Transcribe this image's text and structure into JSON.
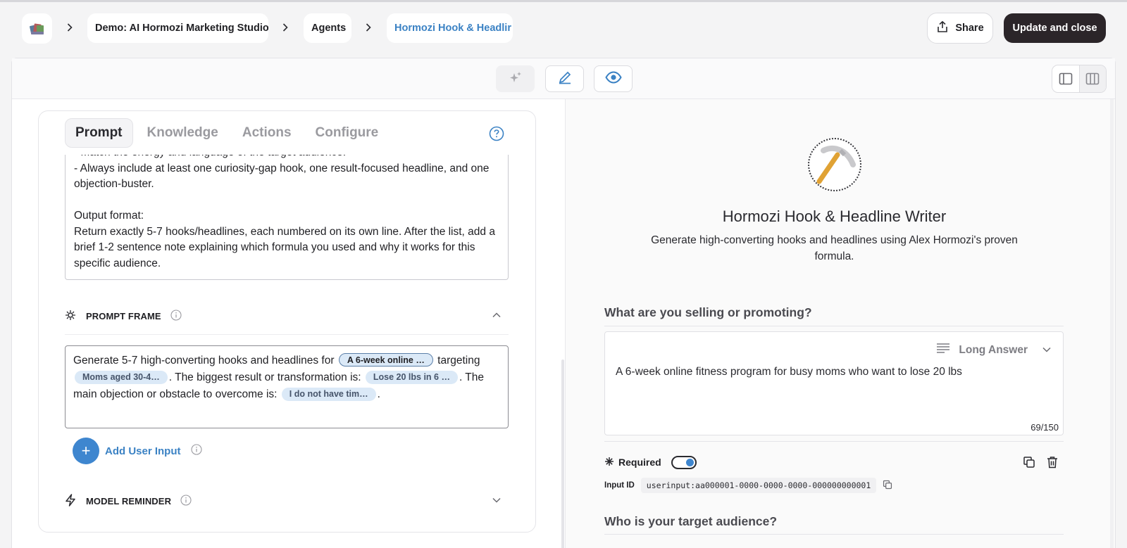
{
  "breadcrumb": {
    "items": [
      {
        "label": "Demo: AI Hormozi Marketing Studio"
      },
      {
        "label": "Agents"
      },
      {
        "label": "Hormozi Hook & Headlir"
      }
    ]
  },
  "header": {
    "share_label": "Share",
    "update_label": "Update and close"
  },
  "left": {
    "tabs": [
      {
        "label": "Prompt",
        "active": true
      },
      {
        "label": "Knowledge"
      },
      {
        "label": "Actions"
      },
      {
        "label": "Configure"
      }
    ],
    "prompt_lines": [
      "- Match the energy and language of the target audience.",
      "- Always include at least one curiosity-gap hook, one result-focused headline, and one",
      "objection-buster.",
      "",
      "Output format:",
      "Return exactly 5-7 hooks/headlines, each numbered on its own line. After the list, add a",
      "brief 1-2 sentence note explaining which formula you used and why it works for this",
      "specific audience."
    ],
    "prompt_frame": {
      "title": "PROMPT FRAME",
      "seg1": "Generate 5-7 high-converting hooks and headlines for",
      "chip1": "A 6-week online …",
      "seg2": "targeting",
      "chip2": "Moms aged 30-4…",
      "seg3": ". The biggest result or transformation is:",
      "chip3": "Lose 20 lbs in 6 …",
      "seg4": ". The main objection or obstacle to overcome is:",
      "chip4": "I do not have tim…",
      "seg5": "."
    },
    "add_user_input_label": "Add User Input",
    "model_reminder_title": "MODEL REMINDER"
  },
  "right": {
    "agent_name": "Hormozi Hook & Headline Writer",
    "agent_description": "Generate high-converting hooks and headlines using Alex Hormozi's proven formula.",
    "question1": {
      "label": "What are you selling or promoting?",
      "type_label": "Long Answer",
      "value": "A 6-week online fitness program for busy moms who want to lose 20 lbs",
      "counter": "69/150",
      "required_label": "Required",
      "required": true,
      "input_id_label": "Input ID",
      "input_id": "userinput:aa000001-0000-0000-0000-000000000001"
    },
    "question2": {
      "label": "Who is your target audience?"
    }
  },
  "colors": {
    "accent": "#3e86cf",
    "primary_button": "#2b2529",
    "chip_bg": "#dbe9f7"
  },
  "icons": [
    "app-logo-icon",
    "chevron-right-icon",
    "share-icon",
    "sparkle-icon",
    "pencil-icon",
    "eye-icon",
    "sidebar-layout-icon",
    "columns-layout-icon",
    "help-icon",
    "prompt-frame-icon",
    "info-icon",
    "chevron-up-icon",
    "chevron-down-icon",
    "plus-icon",
    "lightning-icon",
    "pickaxe-icon",
    "text-lines-icon",
    "asterisk-icon",
    "copy-icon",
    "trash-icon"
  ]
}
